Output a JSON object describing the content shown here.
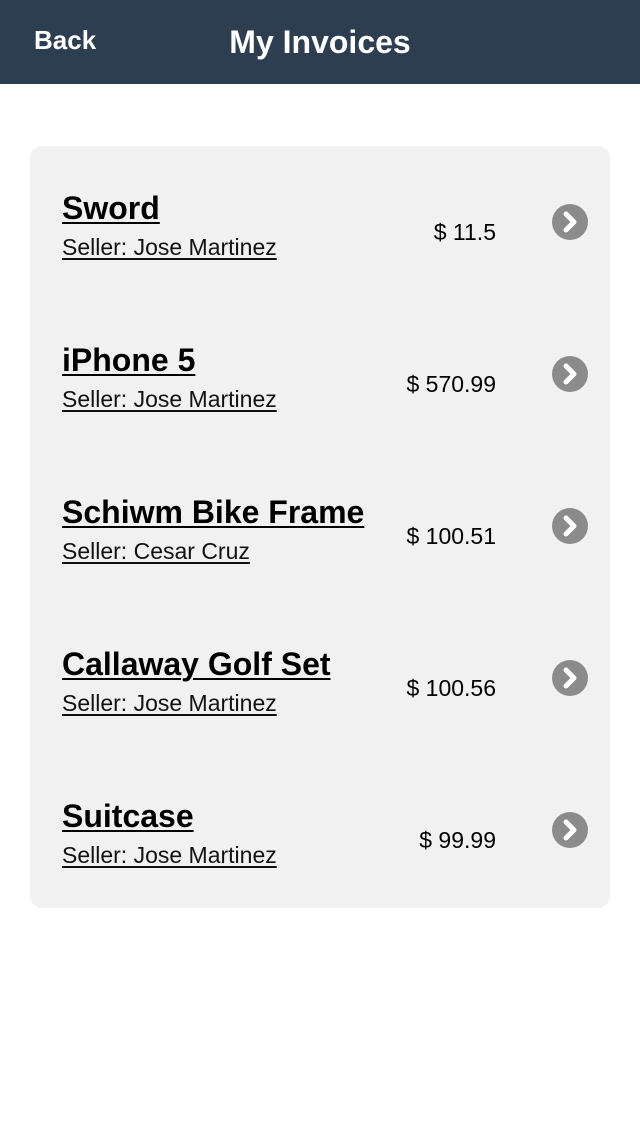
{
  "navbar": {
    "back_label": "Back",
    "title": "My Invoices",
    "background_color": "#2e3e51"
  },
  "invoices": [
    {
      "name": "Sword",
      "seller": "Seller: Jose Martinez",
      "price": "$ 11.5",
      "icon": "chevron-right-circle-icon"
    },
    {
      "name": "iPhone 5",
      "seller": "Seller: Jose Martinez",
      "price": "$ 570.99",
      "icon": "chevron-right-circle-icon"
    },
    {
      "name": "Schiwm Bike Frame",
      "seller": "Seller: Cesar Cruz",
      "price": "$ 100.51",
      "icon": "chevron-right-circle-icon"
    },
    {
      "name": "Callaway Golf Set",
      "seller": "Seller: Jose Martinez",
      "price": "$ 100.56",
      "icon": "chevron-right-circle-icon"
    },
    {
      "name": "Suitcase",
      "seller": "Seller: Jose Martinez",
      "price": "$ 99.99",
      "icon": "chevron-right-circle-icon"
    }
  ]
}
